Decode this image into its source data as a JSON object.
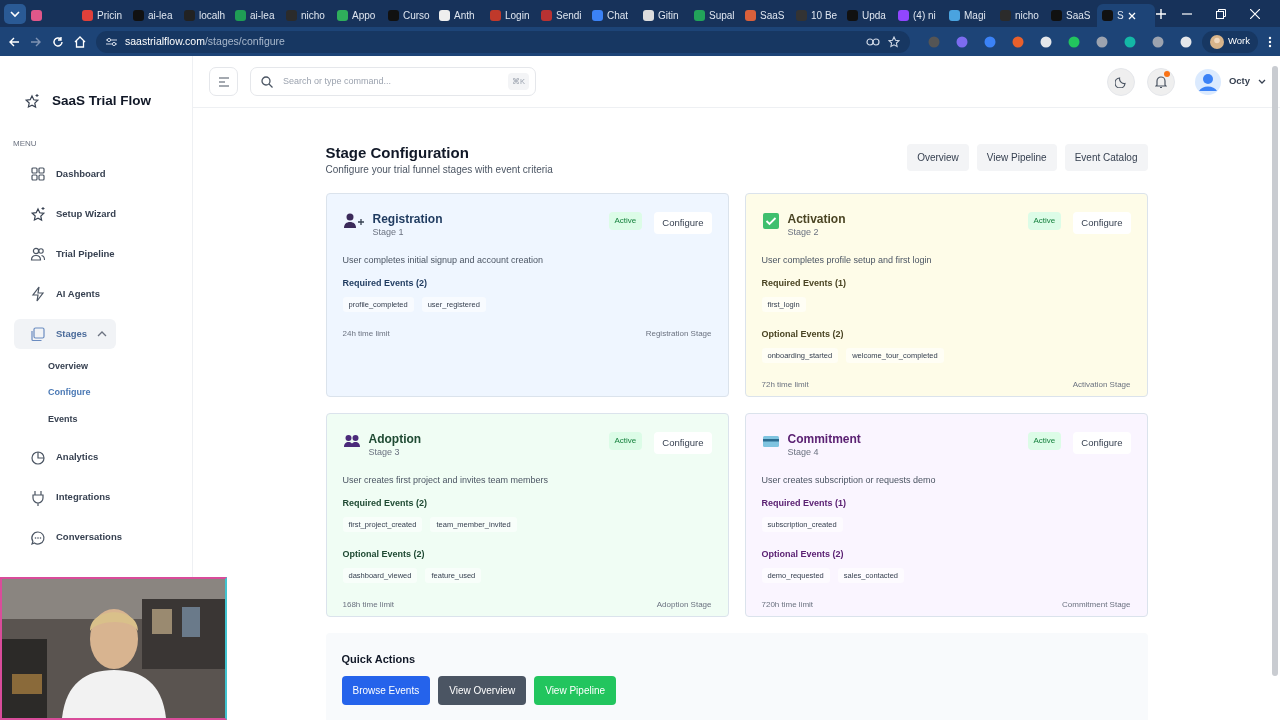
{
  "browser": {
    "tabs": [
      {
        "color": "#e0578a",
        "selected": false
      },
      {
        "title": "Pricin",
        "color": "#e0403a",
        "selected": false
      },
      {
        "title": "ai-lea",
        "color": "#111111",
        "selected": false
      },
      {
        "title": "localh",
        "color": "#222222",
        "selected": false
      },
      {
        "title": "ai-lea",
        "color": "#1f9d55",
        "selected": false
      },
      {
        "title": "nicho",
        "color": "#2b2b2b",
        "selected": false
      },
      {
        "title": "Appo",
        "color": "#2fae5b",
        "selected": false
      },
      {
        "title": "Curso",
        "color": "#111111",
        "selected": false
      },
      {
        "title": "Anth",
        "color": "#eeeeee",
        "selected": false
      },
      {
        "title": "Login",
        "color": "#c0392b",
        "selected": false
      },
      {
        "title": "Sendi",
        "color": "#b83232",
        "selected": false
      },
      {
        "title": "Chat",
        "color": "#3b82f6",
        "selected": false
      },
      {
        "title": "Gitin",
        "color": "#dddddd",
        "selected": false
      },
      {
        "title": "Supal",
        "color": "#22a35a",
        "selected": false
      },
      {
        "title": "SaaS",
        "color": "#d9603b",
        "selected": false
      },
      {
        "title": "10 Be",
        "color": "#333333",
        "selected": false
      },
      {
        "title": "Upda",
        "color": "#111111",
        "selected": false
      },
      {
        "title": "(4) ni",
        "color": "#9146ff",
        "selected": false
      },
      {
        "title": "Magi",
        "color": "#4aa3df",
        "selected": false
      },
      {
        "title": "nicho",
        "color": "#2b2b2b",
        "selected": false
      },
      {
        "title": "SaaS",
        "color": "#111111",
        "selected": false
      },
      {
        "title": "S",
        "color": "#111111",
        "selected": true
      }
    ],
    "url_host": "saastrialflow.com",
    "url_path": "/stages/configure",
    "profile": "Work"
  },
  "sidebar": {
    "brand": "SaaS Trial Flow",
    "section": "MENU",
    "items": [
      {
        "label": "Dashboard",
        "kind": "grid",
        "selected": false
      },
      {
        "label": "Setup Wizard",
        "kind": "sparkle",
        "selected": false
      },
      {
        "label": "Trial Pipeline",
        "kind": "people",
        "selected": false
      },
      {
        "label": "AI Agents",
        "kind": "bolt",
        "selected": false
      },
      {
        "label": "Stages",
        "kind": "stack",
        "selected": true,
        "expanded": true,
        "children": [
          {
            "label": "Overview",
            "selected": false
          },
          {
            "label": "Configure",
            "selected": true
          },
          {
            "label": "Events",
            "selected": false
          }
        ]
      },
      {
        "label": "Analytics",
        "kind": "pie",
        "selected": false
      },
      {
        "label": "Integrations",
        "kind": "plug",
        "selected": false
      },
      {
        "label": "Conversations",
        "kind": "chat",
        "selected": false
      }
    ]
  },
  "topbar": {
    "search": {
      "placeholder": "Search or type command...",
      "shortcut": "⌘K"
    },
    "notification": true,
    "user": "Octy"
  },
  "page": {
    "title": "Stage Configuration",
    "subtitle": "Configure your trial funnel stages with event criteria",
    "buttons": [
      "Overview",
      "View Pipeline",
      "Event Catalog"
    ]
  },
  "stages": [
    {
      "kind": "person-plus",
      "title": "Registration",
      "stage": "Stage 1",
      "color": "#eff6ff",
      "status": "Active",
      "action": "Configure",
      "description": "User completes initial signup and account creation",
      "required_label": "Required Events (2)",
      "required": [
        "profile_completed",
        "user_registered"
      ],
      "time_limit": "24h time limit",
      "footer": "Registration Stage"
    },
    {
      "kind": "check",
      "title": "Activation",
      "stage": "Stage 2",
      "color": "#fefce8",
      "status": "Active",
      "action": "Configure",
      "description": "User completes profile setup and first login",
      "required_label": "Required Events (1)",
      "required": [
        "first_login"
      ],
      "optional_label": "Optional Events (2)",
      "optional": [
        "onboarding_started",
        "welcome_tour_completed"
      ],
      "time_limit": "72h time limit",
      "footer": "Activation Stage"
    },
    {
      "kind": "people",
      "title": "Adoption",
      "stage": "Stage 3",
      "color": "#f0fdf4",
      "status": "Active",
      "action": "Configure",
      "description": "User creates first project and invites team members",
      "required_label": "Required Events (2)",
      "required": [
        "first_project_created",
        "team_member_invited"
      ],
      "optional_label": "Optional Events (2)",
      "optional": [
        "dashboard_viewed",
        "feature_used"
      ],
      "time_limit": "168h time limit",
      "footer": "Adoption Stage"
    },
    {
      "kind": "card",
      "title": "Commitment",
      "stage": "Stage 4",
      "color": "#faf5ff",
      "status": "Active",
      "action": "Configure",
      "description": "User creates subscription or requests demo",
      "required_label": "Required Events (1)",
      "required": [
        "subscription_created"
      ],
      "optional_label": "Optional Events (2)",
      "optional": [
        "demo_requested",
        "sales_contacted"
      ],
      "time_limit": "720h time limit",
      "footer": "Commitment Stage"
    }
  ],
  "quick_actions": {
    "title": "Quick Actions",
    "buttons": [
      {
        "label": "Browse Events",
        "color": "#2563eb"
      },
      {
        "label": "View Overview",
        "color": "#4b5563"
      },
      {
        "label": "View Pipeline",
        "color": "#22c55e"
      }
    ]
  }
}
